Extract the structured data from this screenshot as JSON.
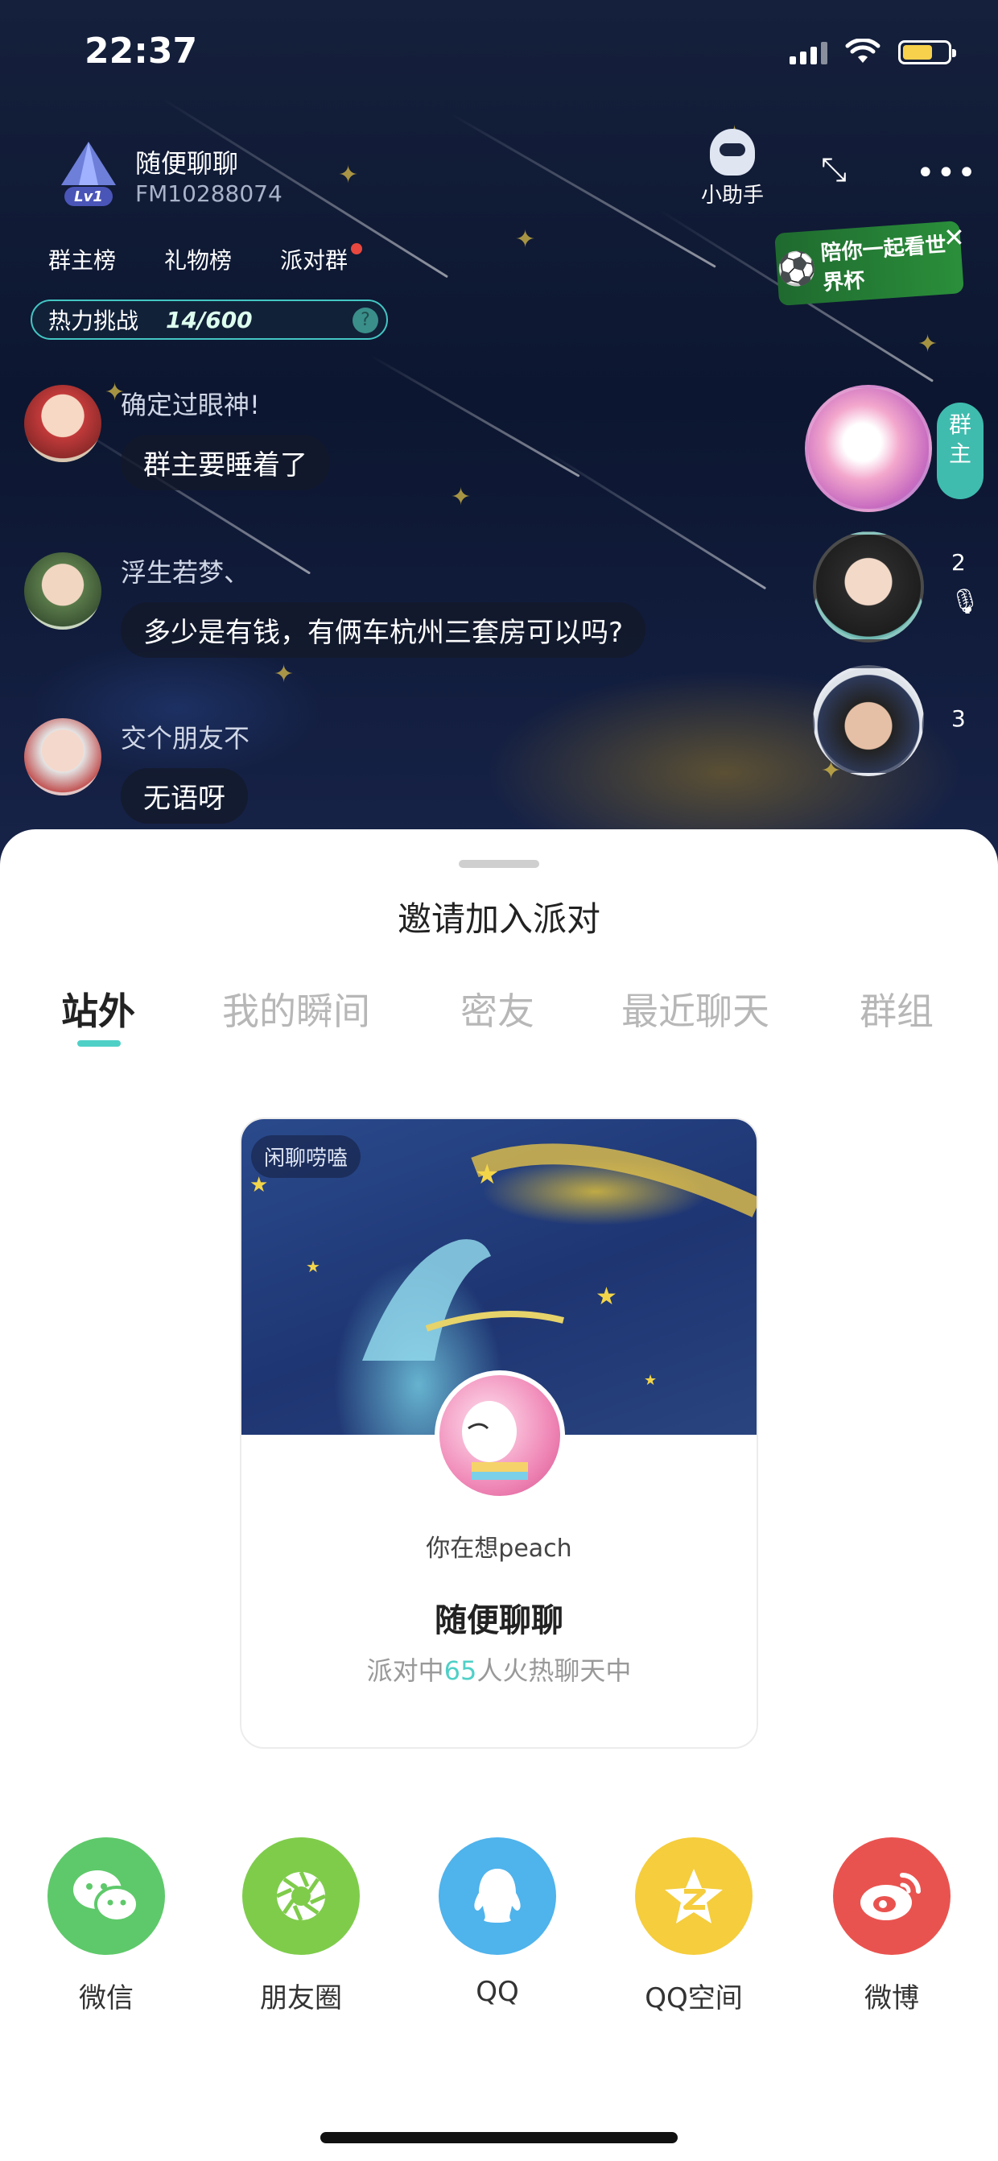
{
  "status_bar": {
    "time": "22:37"
  },
  "room": {
    "title": "随便聊聊",
    "id": "FM10288074",
    "level_badge": "Lv1",
    "helper_label": "小助手",
    "tabs": [
      "群主榜",
      "礼物榜",
      "派对群"
    ],
    "promo_banner": "陪你一起看世界杯",
    "hot_challenge": {
      "label": "热力挑战",
      "progress": "14/600",
      "help": "?"
    },
    "owner_tag": "群主",
    "seat_numbers": [
      "2",
      "3"
    ]
  },
  "chat": [
    {
      "name": "确定过眼神!",
      "message": "群主要睡着了"
    },
    {
      "name": "浮生若梦、",
      "message": "多少是有钱，有俩车杭州三套房可以吗?"
    },
    {
      "name": "交个朋友不",
      "message": "无语呀"
    }
  ],
  "sheet": {
    "title": "邀请加入派对",
    "tabs": [
      "站外",
      "我的瞬间",
      "密友",
      "最近聊天",
      "群组"
    ],
    "active_tab_index": 0,
    "card": {
      "cover_tag": "闲聊唠嗑",
      "host_name": "你在想peach",
      "room_name": "随便聊聊",
      "desc_prefix": "派对中",
      "desc_count": "65",
      "desc_suffix": "人火热聊天中"
    },
    "shares": [
      {
        "label": "微信",
        "icon": "wechat-icon",
        "color": "#5ec96a"
      },
      {
        "label": "朋友圈",
        "icon": "moments-icon",
        "color": "#7fcc4b"
      },
      {
        "label": "QQ",
        "icon": "qq-icon",
        "color": "#4fb3ec"
      },
      {
        "label": "QQ空间",
        "icon": "qzone-icon",
        "color": "#f5cd3d"
      },
      {
        "label": "微博",
        "icon": "weibo-icon",
        "color": "#e9534f"
      }
    ]
  }
}
